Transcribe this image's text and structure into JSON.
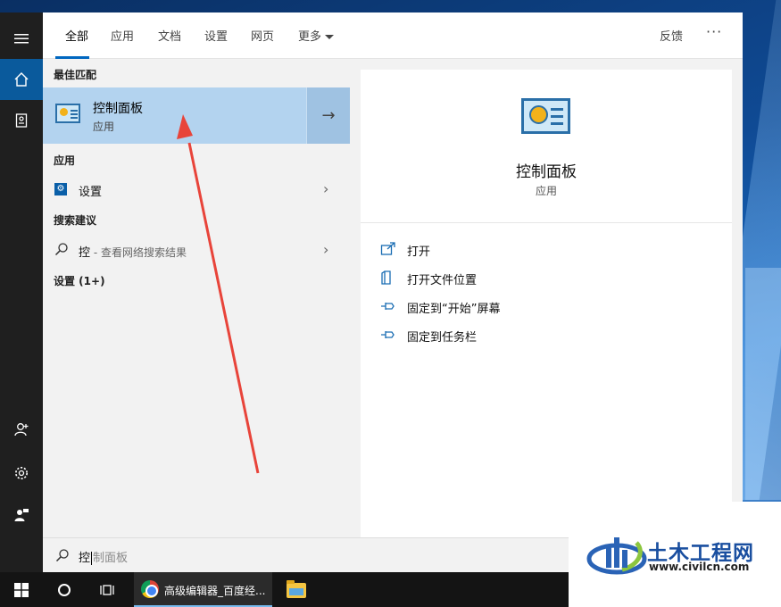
{
  "tabs": [
    "全部",
    "应用",
    "文档",
    "设置",
    "网页",
    "更多"
  ],
  "header": {
    "feedback": "反馈",
    "more_dots": "···"
  },
  "results": {
    "best_match_heading": "最佳匹配",
    "best_match": {
      "title": "控制面板",
      "subtitle": "应用",
      "arrow": "→"
    },
    "apps_heading": "应用",
    "settings_item": "设置",
    "suggestions_heading": "搜索建议",
    "suggestion_query": "控",
    "suggestion_hint": " - 查看网络搜索结果",
    "settings_count_heading": "设置 (1+)"
  },
  "preview": {
    "title": "控制面板",
    "subtitle": "应用",
    "actions": [
      "打开",
      "打开文件位置",
      "固定到“开始”屏幕",
      "固定到任务栏"
    ]
  },
  "search": {
    "typed": "控",
    "ghost": "制面板"
  },
  "taskbar": {
    "chrome_label": "高级编辑器_百度经..."
  },
  "watermark": {
    "name": "土木工程网",
    "url": "www.civilcn.com"
  },
  "colors": {
    "accent": "#0067c0",
    "selection": "#b3d3ef",
    "annotation_arrow": "#e8443a"
  }
}
